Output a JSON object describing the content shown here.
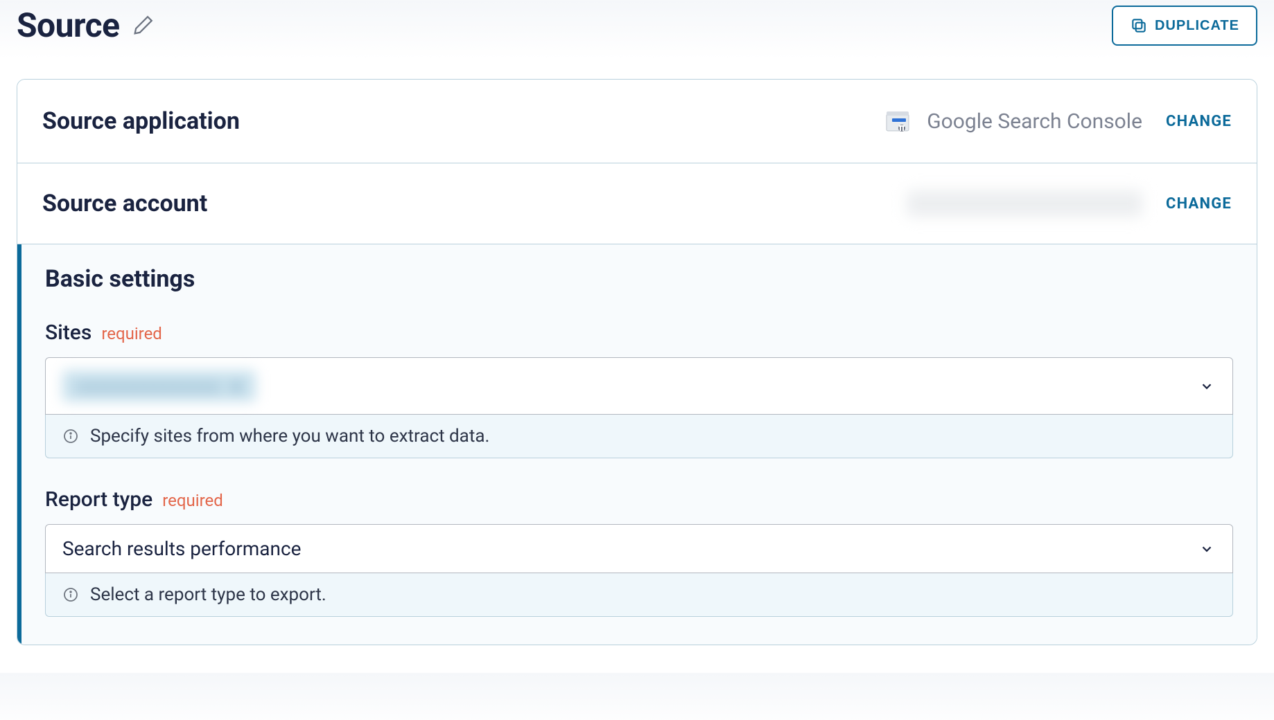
{
  "header": {
    "title": "Source",
    "duplicate_label": "DUPLICATE"
  },
  "app_row": {
    "label": "Source application",
    "value": "Google Search Console",
    "action": "CHANGE"
  },
  "account_row": {
    "label": "Source account",
    "value": "",
    "action": "CHANGE"
  },
  "settings": {
    "heading": "Basic settings",
    "sites": {
      "label": "Sites",
      "required": "required",
      "selected": "",
      "hint": "Specify sites from where you want to extract data."
    },
    "report_type": {
      "label": "Report type",
      "required": "required",
      "selected": "Search results performance",
      "hint": "Select a report type to export."
    }
  }
}
